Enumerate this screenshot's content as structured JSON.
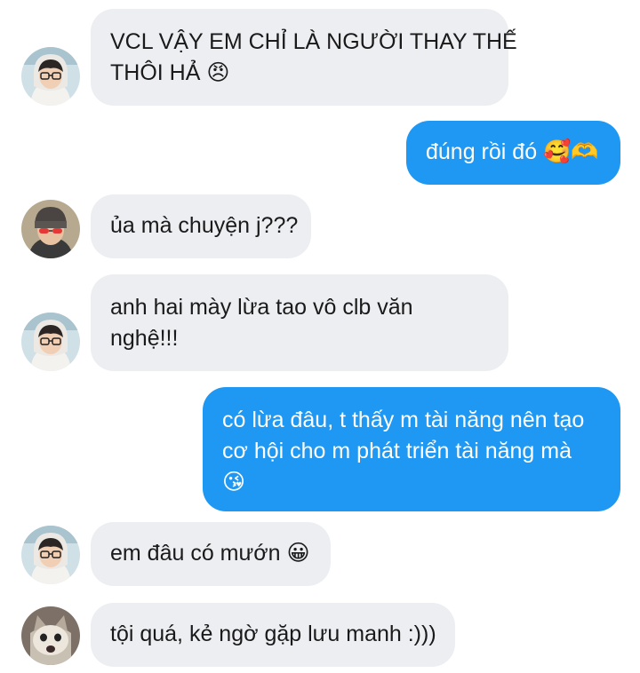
{
  "messages": [
    {
      "sender": "friend-glasses",
      "direction": "in",
      "lines": [
        "VCL VẬY EM CHỈ LÀ NGƯỜI THAY THẾ",
        "THÔI HẢ 😠"
      ]
    },
    {
      "sender": "me",
      "direction": "out",
      "lines": [
        "đúng rồi đó 🥰🫶"
      ]
    },
    {
      "sender": "friend-beanie",
      "direction": "in",
      "lines": [
        "ủa mà chuyện j???"
      ]
    },
    {
      "sender": "friend-glasses",
      "direction": "in",
      "lines": [
        "anh hai mày lừa tao vô clb văn",
        "nghệ!!!"
      ]
    },
    {
      "sender": "me",
      "direction": "out",
      "lines": [
        "có lừa đâu, t thấy m tài năng nên tạo",
        "cơ hội cho m phát triển tài năng mà",
        "😘"
      ]
    },
    {
      "sender": "friend-glasses",
      "direction": "in",
      "lines": [
        "em đâu có mướn 😀"
      ]
    },
    {
      "sender": "friend-cat",
      "direction": "in",
      "lines": [
        "tội quá, kẻ ngờ gặp lưu manh :)))"
      ]
    }
  ],
  "colors": {
    "incoming_bubble": "#eceef2",
    "outgoing_bubble": "#1e98f2",
    "incoming_text": "#1a1a1a",
    "outgoing_text": "#ffffff"
  }
}
